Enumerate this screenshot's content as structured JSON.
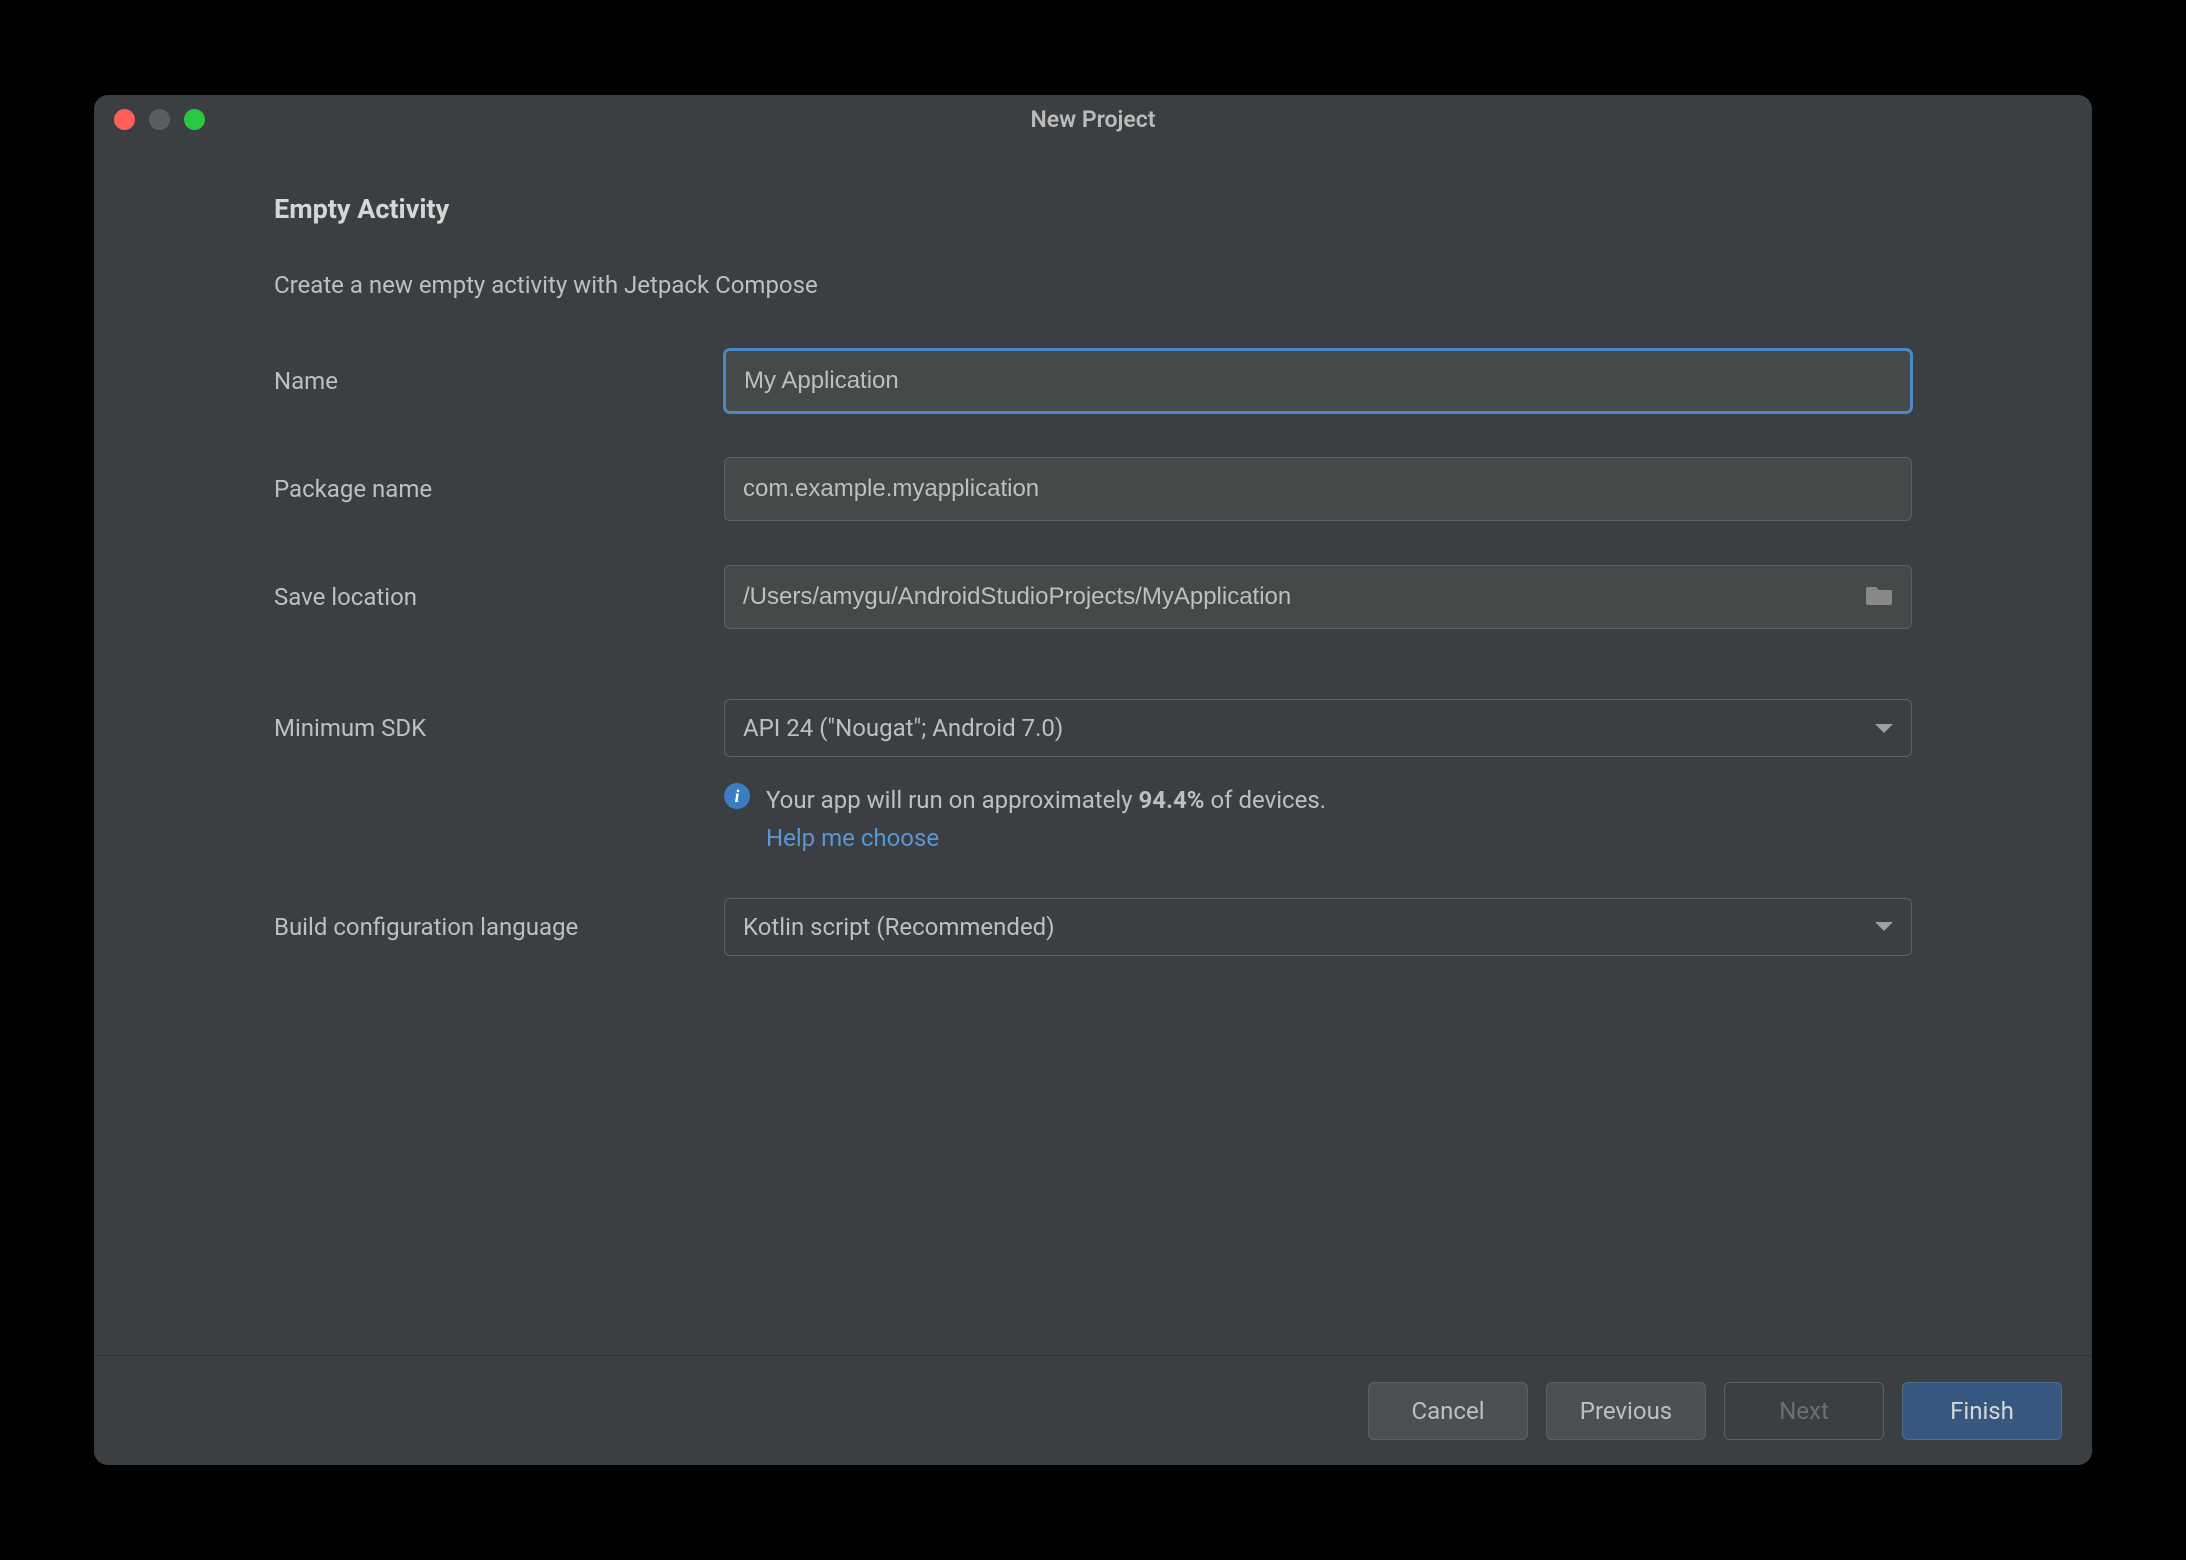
{
  "window": {
    "title": "New Project"
  },
  "page": {
    "heading": "Empty Activity",
    "description": "Create a new empty activity with Jetpack Compose"
  },
  "form": {
    "name_label": "Name",
    "name_value": "My Application",
    "package_label": "Package name",
    "package_value": "com.example.myapplication",
    "location_label": "Save location",
    "location_value": "/Users/amygu/AndroidStudioProjects/MyApplication",
    "sdk_label": "Minimum SDK",
    "sdk_value": "API 24 (\"Nougat\"; Android 7.0)",
    "sdk_info_prefix": "Your app will run on approximately ",
    "sdk_info_pct": "94.4%",
    "sdk_info_suffix": " of devices.",
    "sdk_help": "Help me choose",
    "build_label": "Build configuration language",
    "build_value": "Kotlin script (Recommended)"
  },
  "footer": {
    "cancel": "Cancel",
    "previous": "Previous",
    "next": "Next",
    "finish": "Finish"
  }
}
